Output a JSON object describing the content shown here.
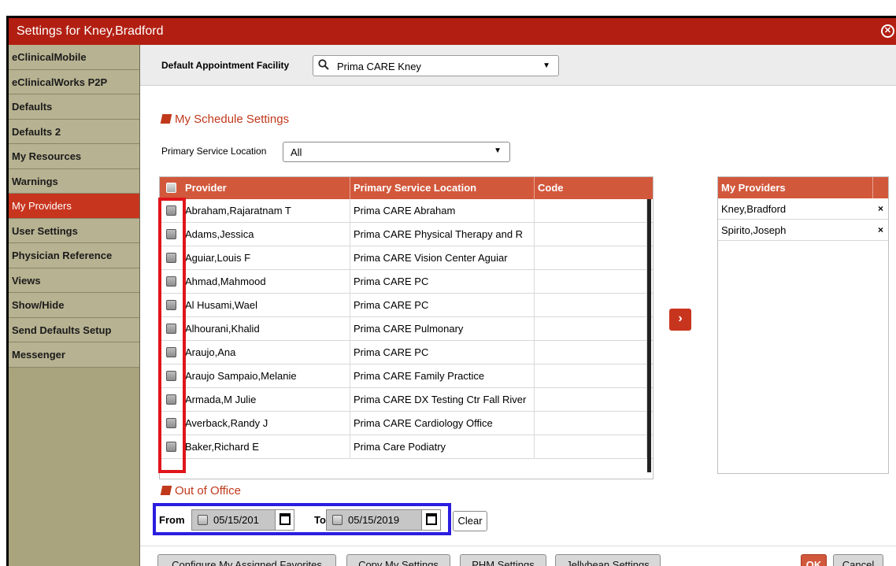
{
  "window": {
    "title": "Settings for Kney,Bradford",
    "close_glyph": "⊗"
  },
  "sidebar": {
    "items": [
      {
        "label": "eClinicalMobile",
        "active": false
      },
      {
        "label": "eClinicalWorks P2P",
        "active": false
      },
      {
        "label": "Defaults",
        "active": false
      },
      {
        "label": "Defaults 2",
        "active": false
      },
      {
        "label": "My Resources",
        "active": false
      },
      {
        "label": "Warnings",
        "active": false
      },
      {
        "label": "My Providers",
        "active": true
      },
      {
        "label": "User Settings",
        "active": false
      },
      {
        "label": "Physician Reference",
        "active": false
      },
      {
        "label": "Views",
        "active": false
      },
      {
        "label": "Show/Hide",
        "active": false
      },
      {
        "label": "Send Defaults Setup",
        "active": false
      },
      {
        "label": "Messenger",
        "active": false
      }
    ]
  },
  "facility": {
    "label": "Default Appointment Facility",
    "value": "Prima CARE Kney",
    "search_icon": "search-icon",
    "caret": "▼"
  },
  "schedule": {
    "title": "My Schedule Settings",
    "psl_label": "Primary Service Location",
    "psl_value": "All",
    "caret": "▼"
  },
  "providers_table": {
    "columns": [
      "Provider",
      "Primary Service Location",
      "Code"
    ],
    "rows": [
      {
        "provider": "Abraham,Rajaratnam T",
        "location": "Prima CARE Abraham",
        "code": ""
      },
      {
        "provider": "Adams,Jessica",
        "location": "Prima CARE Physical Therapy and R",
        "code": ""
      },
      {
        "provider": "Aguiar,Louis F",
        "location": "Prima CARE Vision Center Aguiar",
        "code": ""
      },
      {
        "provider": "Ahmad,Mahmood",
        "location": "Prima CARE PC",
        "code": ""
      },
      {
        "provider": "Al Husami,Wael",
        "location": "Prima CARE PC",
        "code": ""
      },
      {
        "provider": "Alhourani,Khalid",
        "location": "Prima CARE Pulmonary",
        "code": ""
      },
      {
        "provider": "Araujo,Ana",
        "location": "Prima CARE PC",
        "code": ""
      },
      {
        "provider": "Araujo Sampaio,Melanie",
        "location": "Prima CARE Family Practice",
        "code": ""
      },
      {
        "provider": "Armada,M Julie",
        "location": "Prima CARE DX Testing Ctr Fall River",
        "code": ""
      },
      {
        "provider": "Averback,Randy J",
        "location": "Prima CARE Cardiology Office",
        "code": ""
      },
      {
        "provider": "Baker,Richard E",
        "location": "Prima Care Podiatry",
        "code": ""
      }
    ]
  },
  "move_button": {
    "glyph": "›"
  },
  "my_providers": {
    "title": "My Providers",
    "rows": [
      {
        "name": "Kney,Bradford",
        "remove": "×"
      },
      {
        "name": "Spirito,Joseph",
        "remove": "×"
      }
    ]
  },
  "out_of_office": {
    "title": "Out of Office",
    "from_label": "From",
    "from_value": "05/15/201",
    "to_label": "To",
    "to_value": "05/15/2019",
    "clear_label": "Clear"
  },
  "bottom": {
    "configure_label": "Configure My Assigned Favorites",
    "copy_label": "Copy My Settings",
    "phm_label": "PHM Settings",
    "jellybean_label": "Jellybean Settings",
    "ok_label": "OK",
    "cancel_label": "Cancel"
  },
  "colors": {
    "titlebar": "#b21f12",
    "accent": "#d2583c",
    "sidebar": "#b7b291",
    "highlight_red": "#e0151b",
    "highlight_blue": "#2b1de0"
  }
}
